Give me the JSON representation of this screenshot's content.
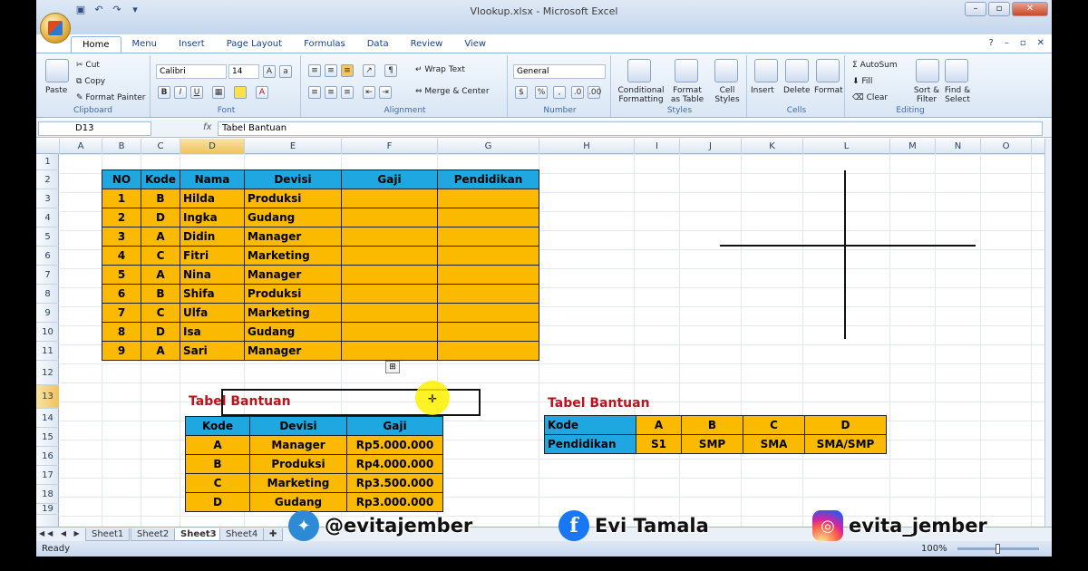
{
  "window": {
    "title": "Vlookup.xlsx - Microsoft Excel",
    "min": "–",
    "max": "▫",
    "close": "✕"
  },
  "tabs": [
    "Home",
    "Menu",
    "Insert",
    "Page Layout",
    "Formulas",
    "Data",
    "Review",
    "View"
  ],
  "ribbon": {
    "clipboard": {
      "label": "Clipboard",
      "paste": "Paste",
      "cut": "Cut",
      "copy": "Copy",
      "format_painter": "Format Painter"
    },
    "font": {
      "label": "Font",
      "name": "Calibri",
      "size": "14",
      "bold": "B",
      "italic": "I",
      "underline": "U"
    },
    "alignment": {
      "label": "Alignment",
      "wrap": "Wrap Text",
      "merge": "Merge & Center"
    },
    "number": {
      "label": "Number",
      "format": "General",
      "percent": "%",
      "comma": ","
    },
    "styles": {
      "label": "Styles",
      "conditional": "Conditional",
      "conditional2": "Formatting",
      "format_table": "Format",
      "format_table2": "as Table",
      "cell_styles": "Cell",
      "cell_styles2": "Styles"
    },
    "cells": {
      "label": "Cells",
      "insert": "Insert",
      "delete": "Delete",
      "format": "Format"
    },
    "editing": {
      "label": "Editing",
      "autosum": "AutoSum",
      "fill": "Fill",
      "clear": "Clear",
      "sort": "Sort &",
      "sort2": "Filter",
      "find": "Find &",
      "find2": "Select"
    }
  },
  "formula_bar": {
    "name_box": "D13",
    "fx": "fx",
    "content": "Tabel Bantuan"
  },
  "columns": [
    "A",
    "B",
    "C",
    "D",
    "E",
    "F",
    "G",
    "H",
    "I",
    "J",
    "K",
    "L",
    "M",
    "N",
    "O"
  ],
  "rows": [
    "1",
    "2",
    "3",
    "4",
    "5",
    "6",
    "7",
    "8",
    "9",
    "10",
    "11",
    "12",
    "13",
    "14",
    "15",
    "16",
    "17",
    "18",
    "19"
  ],
  "main_table": {
    "headers": [
      "NO",
      "Kode",
      "Nama",
      "Devisi",
      "Gaji",
      "Pendidikan"
    ],
    "rows": [
      [
        "1",
        "B",
        "Hilda",
        "Produksi",
        "",
        ""
      ],
      [
        "2",
        "D",
        "Ingka",
        "Gudang",
        "",
        ""
      ],
      [
        "3",
        "A",
        "Didin",
        "Manager",
        "",
        ""
      ],
      [
        "4",
        "C",
        "Fitri",
        "Marketing",
        "",
        ""
      ],
      [
        "5",
        "A",
        "Nina",
        "Manager",
        "",
        ""
      ],
      [
        "6",
        "B",
        "Shifa",
        "Produksi",
        "",
        ""
      ],
      [
        "7",
        "C",
        "Ulfa",
        "Marketing",
        "",
        ""
      ],
      [
        "8",
        "D",
        "Isa",
        "Gudang",
        "",
        ""
      ],
      [
        "9",
        "A",
        "Sari",
        "Manager",
        "",
        ""
      ]
    ]
  },
  "helper_table_1": {
    "title": "Tabel Bantuan",
    "headers": [
      "Kode",
      "Devisi",
      "Gaji"
    ],
    "rows": [
      [
        "A",
        "Manager",
        "Rp5.000.000"
      ],
      [
        "B",
        "Produksi",
        "Rp4.000.000"
      ],
      [
        "C",
        "Marketing",
        "Rp3.500.000"
      ],
      [
        "D",
        "Gudang",
        "Rp3.000.000"
      ]
    ]
  },
  "helper_table_2": {
    "title": "Tabel Bantuan",
    "row_labels": [
      "Kode",
      "Pendidikan"
    ],
    "codes": [
      "A",
      "B",
      "C",
      "D"
    ],
    "values": [
      "S1",
      "SMP",
      "SMA",
      "SMA/SMP"
    ]
  },
  "sheets": [
    "Sheet1",
    "Sheet2",
    "Sheet3",
    "Sheet4"
  ],
  "active_sheet": "Sheet3",
  "status": {
    "ready": "Ready",
    "zoom": "100%"
  },
  "social": {
    "twitter": "@evitajember",
    "facebook": "Evi Tamala",
    "instagram": "evita_jember"
  },
  "colors": {
    "header_blue": "#1ea7e0",
    "cell_orange": "#fbb900",
    "title_red": "#b8141c"
  }
}
